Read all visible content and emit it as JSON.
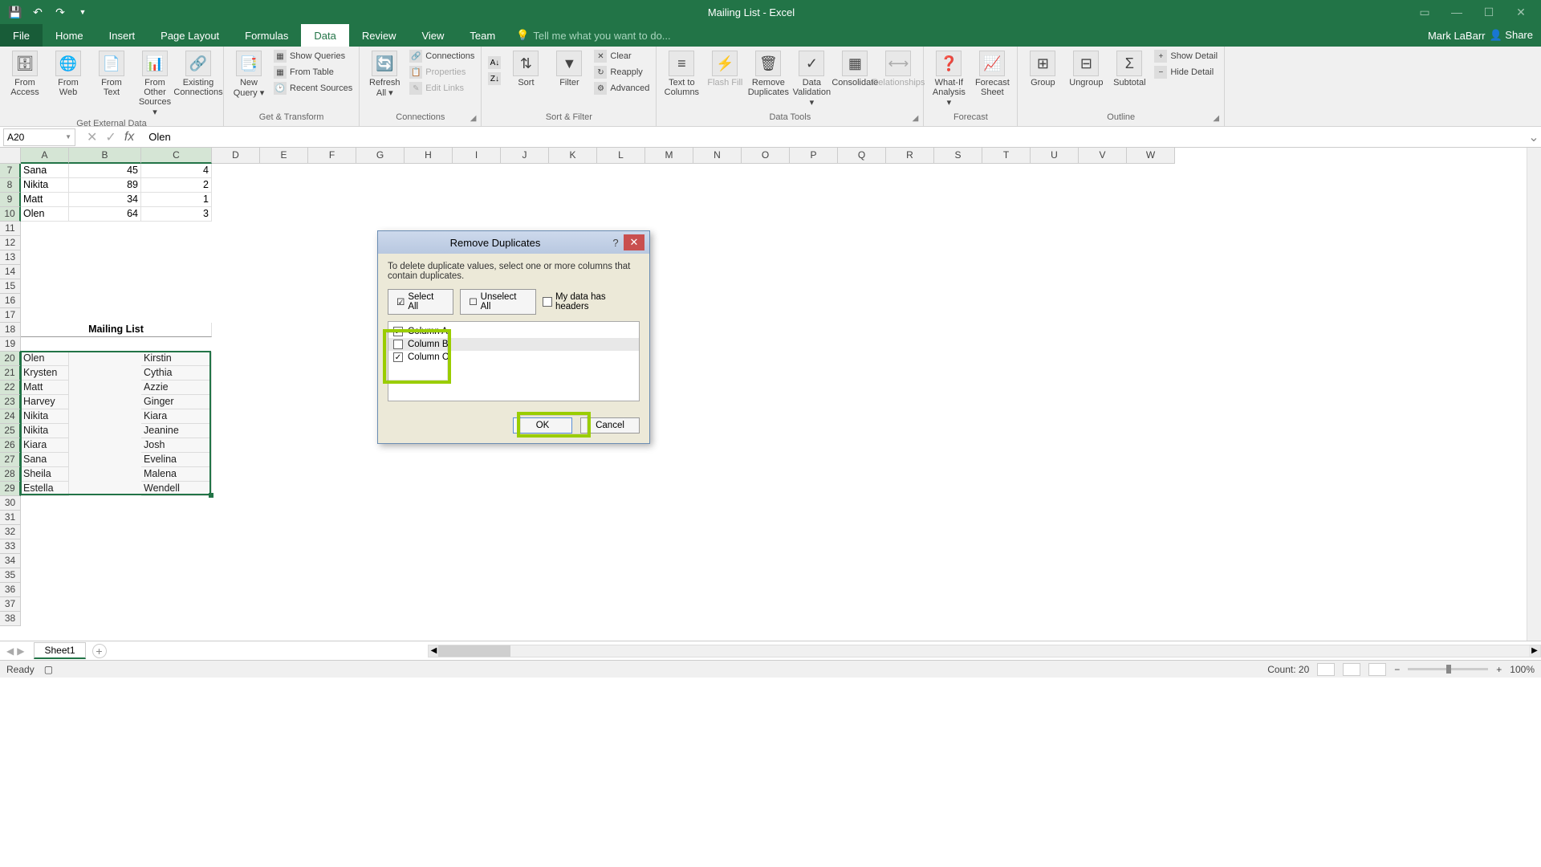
{
  "titlebar": {
    "title": "Mailing List - Excel"
  },
  "tabs": {
    "file": "File",
    "home": "Home",
    "insert": "Insert",
    "pagelayout": "Page Layout",
    "formulas": "Formulas",
    "data": "Data",
    "review": "Review",
    "view": "View",
    "team": "Team",
    "tellme": "Tell me what you want to do..."
  },
  "user": {
    "name": "Mark LaBarr",
    "share": "Share"
  },
  "ribbon": {
    "ext_data": {
      "access": "From Access",
      "web": "From Web",
      "text": "From Text",
      "other": "From Other Sources ▾",
      "existing": "Existing Connections",
      "label": "Get External Data"
    },
    "get_transform": {
      "new_query": "New Query ▾",
      "show_queries": "Show Queries",
      "from_table": "From Table",
      "recent": "Recent Sources",
      "label": "Get & Transform"
    },
    "connections": {
      "refresh": "Refresh All ▾",
      "connections": "Connections",
      "properties": "Properties",
      "edit_links": "Edit Links",
      "label": "Connections"
    },
    "sort_filter": {
      "sort": "Sort",
      "filter": "Filter",
      "clear": "Clear",
      "reapply": "Reapply",
      "advanced": "Advanced",
      "label": "Sort & Filter"
    },
    "data_tools": {
      "t2c": "Text to Columns",
      "flash": "Flash Fill",
      "remove_dup": "Remove Duplicates",
      "validation": "Data Validation ▾",
      "consolidate": "Consolidate",
      "relationships": "Relationships",
      "label": "Data Tools"
    },
    "forecast": {
      "whatif": "What-If Analysis ▾",
      "forecast": "Forecast Sheet",
      "label": "Forecast"
    },
    "outline": {
      "group": "Group",
      "ungroup": "Ungroup",
      "subtotal": "Subtotal",
      "show_detail": "Show Detail",
      "hide_detail": "Hide Detail",
      "label": "Outline"
    }
  },
  "formula_bar": {
    "name": "A20",
    "value": "Olen"
  },
  "columns": [
    "A",
    "B",
    "C",
    "D",
    "E",
    "F",
    "G",
    "H",
    "I",
    "J",
    "K",
    "L",
    "M",
    "N",
    "O",
    "P",
    "Q",
    "R",
    "S",
    "T",
    "U",
    "V",
    "W"
  ],
  "first_row": 7,
  "row_count": 32,
  "col_widths": {
    "A": 60,
    "B": 90,
    "C": 88,
    "default": 60
  },
  "cells": [
    {
      "r": 7,
      "c": "A",
      "v": "Sana"
    },
    {
      "r": 7,
      "c": "B",
      "v": "45",
      "right": true
    },
    {
      "r": 7,
      "c": "C",
      "v": "4",
      "right": true
    },
    {
      "r": 8,
      "c": "A",
      "v": "Nikita"
    },
    {
      "r": 8,
      "c": "B",
      "v": "89",
      "right": true
    },
    {
      "r": 8,
      "c": "C",
      "v": "2",
      "right": true
    },
    {
      "r": 9,
      "c": "A",
      "v": "Matt"
    },
    {
      "r": 9,
      "c": "B",
      "v": "34",
      "right": true
    },
    {
      "r": 9,
      "c": "C",
      "v": "1",
      "right": true
    },
    {
      "r": 10,
      "c": "A",
      "v": "Olen"
    },
    {
      "r": 10,
      "c": "B",
      "v": "64",
      "right": true
    },
    {
      "r": 10,
      "c": "C",
      "v": "3",
      "right": true
    },
    {
      "r": 18,
      "c": "AB",
      "v": "Mailing List",
      "merged": true,
      "bold": true
    },
    {
      "r": 20,
      "c": "A",
      "v": "Olen"
    },
    {
      "r": 20,
      "c": "C",
      "v": "Kirstin"
    },
    {
      "r": 21,
      "c": "A",
      "v": "Krysten"
    },
    {
      "r": 21,
      "c": "C",
      "v": "Cythia"
    },
    {
      "r": 22,
      "c": "A",
      "v": "Matt"
    },
    {
      "r": 22,
      "c": "C",
      "v": "Azzie"
    },
    {
      "r": 23,
      "c": "A",
      "v": "Harvey"
    },
    {
      "r": 23,
      "c": "C",
      "v": "Ginger"
    },
    {
      "r": 24,
      "c": "A",
      "v": "Nikita"
    },
    {
      "r": 24,
      "c": "C",
      "v": "Kiara"
    },
    {
      "r": 25,
      "c": "A",
      "v": "Nikita"
    },
    {
      "r": 25,
      "c": "C",
      "v": "Jeanine"
    },
    {
      "r": 26,
      "c": "A",
      "v": "Kiara"
    },
    {
      "r": 26,
      "c": "C",
      "v": "Josh"
    },
    {
      "r": 27,
      "c": "A",
      "v": "Sana"
    },
    {
      "r": 27,
      "c": "C",
      "v": "Evelina"
    },
    {
      "r": 28,
      "c": "A",
      "v": "Sheila"
    },
    {
      "r": 28,
      "c": "C",
      "v": "Malena"
    },
    {
      "r": 29,
      "c": "A",
      "v": "Estella"
    },
    {
      "r": 29,
      "c": "C",
      "v": "Wendell"
    }
  ],
  "selection": {
    "r1": 20,
    "c1": "A",
    "r2": 29,
    "c2": "C"
  },
  "dialog": {
    "title": "Remove Duplicates",
    "instr": "To delete duplicate values, select one or more columns that contain duplicates.",
    "select_all": "Select All",
    "unselect_all": "Unselect All",
    "headers": "My data has headers",
    "cols": [
      {
        "label": "Column A",
        "checked": true,
        "sel": false
      },
      {
        "label": "Column B",
        "checked": false,
        "sel": true
      },
      {
        "label": "Column C",
        "checked": true,
        "sel": false
      }
    ],
    "ok": "OK",
    "cancel": "Cancel"
  },
  "sheet": {
    "name": "Sheet1"
  },
  "status": {
    "ready": "Ready",
    "count_label": "Count:",
    "count": "20",
    "zoom": "100%"
  }
}
